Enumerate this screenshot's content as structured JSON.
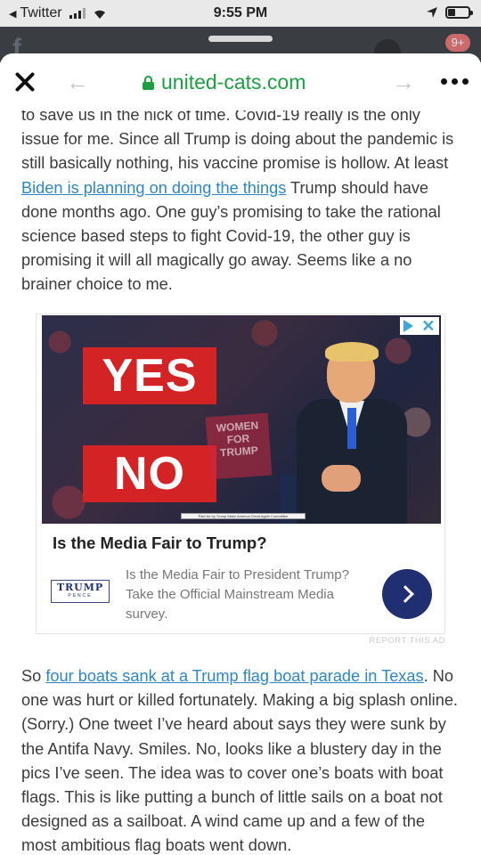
{
  "status_bar": {
    "back_app": "Twitter",
    "time": "9:55 PM",
    "battery_level": 0.35
  },
  "background_app": {
    "notification_badge": "9+"
  },
  "browser": {
    "url": "united-cats.com",
    "icons": [
      "close-icon",
      "back-arrow-icon",
      "lock-icon",
      "forward-arrow-icon",
      "more-icon"
    ]
  },
  "article": {
    "para1": {
      "t1": "to save us in the nick of time. Covid-19 really is the only issue for me. Since all Trump is doing about the pandemic is still basically nothing, his vaccine promise is hollow. At least ",
      "link": "Biden is planning on doing the things",
      "t2": " Trump should have done months ago. One guy’s promising to take the rational science based steps to fight Covid-19, the other guy is promising it will all magically go away. Seems like a no brainer choice to me."
    },
    "para2": {
      "t1": "So ",
      "link": "four boats sank at a Trump flag boat parade in Texas",
      "t2": ". No one was hurt or killed fortunately. Making a big splash online. (Sorry.) One tweet I’ve heard about says they were sunk by the Antifa Navy. Smiles. No, looks like a blustery day in the pics I’ve seen. The idea was to cover one’s boats with boat flags. This is like putting a bunch of little sails on a boat not designed as a sailboat. A wind came up and a few of the most ambitious flag boats went down."
    }
  },
  "ad": {
    "image_yes": "YES",
    "image_no": "NO",
    "image_sign": "WOMEN FOR TRUMP",
    "paid_for": "Paid for by Trump Make America Great Again Committee",
    "headline": "Is the Media Fair to Trump?",
    "logo_main": "TRUMP",
    "logo_sub": "PENCE",
    "description": "Is the Media Fair to President Trump? Take the Official Mainstream Media survey.",
    "report": "REPORT THIS AD",
    "icons": [
      "adchoices-icon",
      "ad-close-icon",
      "chevron-right-icon"
    ]
  }
}
